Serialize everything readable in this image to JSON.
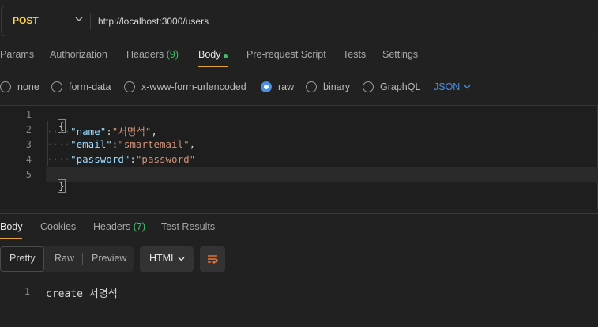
{
  "request": {
    "method": "POST",
    "url": "http://localhost:3000/users"
  },
  "request_tabs": {
    "params": "Params",
    "authorization": "Authorization",
    "headers": "Headers",
    "headers_count": "(9)",
    "body": "Body",
    "prerequest": "Pre-request Script",
    "tests": "Tests",
    "settings": "Settings"
  },
  "body_types": {
    "none": "none",
    "form_data": "form-data",
    "urlencoded": "x-www-form-urlencoded",
    "raw": "raw",
    "binary": "binary",
    "graphql": "GraphQL",
    "selected": "raw",
    "language": "JSON"
  },
  "editor": {
    "line_numbers": [
      "1",
      "2",
      "3",
      "4",
      "5"
    ],
    "open_brace": "{",
    "close_brace": "}",
    "indent": "····",
    "fields": [
      {
        "key": "\"name\"",
        "sep": ":",
        "value": "\"서명석\"",
        "comma": ","
      },
      {
        "key": "\"email\"",
        "sep": ":",
        "value": "\"smartemail\"",
        "comma": ","
      },
      {
        "key": "\"password\"",
        "sep": ":",
        "value": "\"password\"",
        "comma": ""
      }
    ]
  },
  "response_tabs": {
    "body": "Body",
    "cookies": "Cookies",
    "headers": "Headers",
    "headers_count": "(7)",
    "test_results": "Test Results"
  },
  "response_view": {
    "pretty": "Pretty",
    "raw": "Raw",
    "preview": "Preview",
    "format": "HTML"
  },
  "response_body": {
    "line_number": "1",
    "text": "create 서명석"
  },
  "colors": {
    "method": "#ffd24a",
    "accent_tab": "#e8a33b",
    "count": "#3fbf6b",
    "link": "#4a8fdf",
    "json_key": "#9cdcfe",
    "json_string": "#ce9178"
  }
}
